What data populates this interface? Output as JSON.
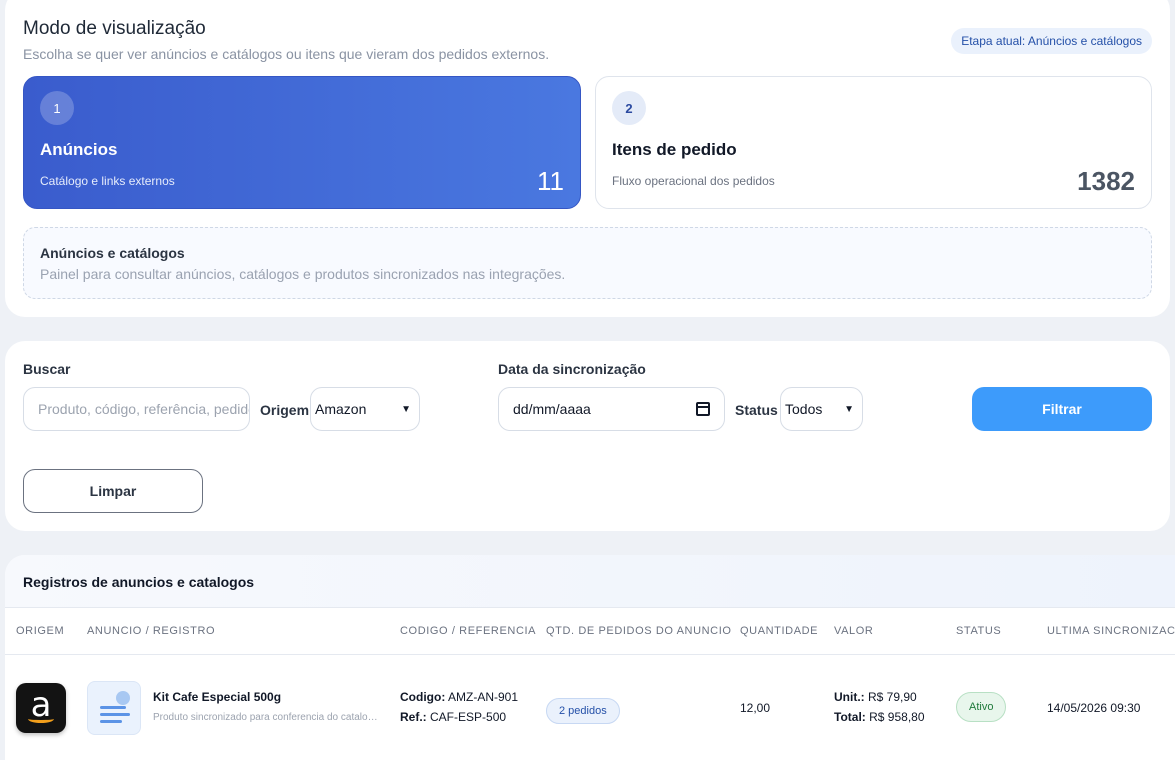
{
  "mode": {
    "title": "Modo de visualização",
    "subtitle": "Escolha se quer ver anúncios e catálogos ou itens que vieram dos pedidos externos.",
    "stage_badge": "Etapa atual: Anúncios e catálogos",
    "options": [
      {
        "num": "1",
        "title": "Anúncios",
        "desc": "Catálogo e links externos",
        "count": "11"
      },
      {
        "num": "2",
        "title": "Itens de pedido",
        "desc": "Fluxo operacional dos pedidos",
        "count": "1382"
      }
    ],
    "info": {
      "title": "Anúncios e catálogos",
      "desc": "Painel para consultar anúncios, catálogos e produtos sincronizados nas integrações."
    }
  },
  "filters": {
    "search_label": "Buscar",
    "search_placeholder": "Produto, código, referência, pedido",
    "origin_label": "Origem",
    "origin_value": "Amazon",
    "date_label": "Data da sincronização",
    "date_placeholder": "dd/mm/aaaa",
    "status_label": "Status",
    "status_value": "Todos",
    "filter_button": "Filtrar",
    "clear_button": "Limpar"
  },
  "table": {
    "title": "Registros de anuncios e catalogos",
    "columns": [
      "ORIGEM",
      "ANUNCIO / REGISTRO",
      "CODIGO / REFERENCIA",
      "QTD. DE PEDIDOS DO ANUNCIO",
      "QUANTIDADE",
      "VALOR",
      "STATUS",
      "ULTIMA SINCRONIZAC"
    ],
    "rows": [
      {
        "origin_icon": "amazon-logo-icon",
        "product_name": "Kit Cafe Especial 500g",
        "product_desc": "Produto sincronizado para conferencia do catalogo...",
        "code_label": "Codigo:",
        "code": "AMZ-AN-901",
        "ref_label": "Ref.:",
        "ref": "CAF-ESP-500",
        "orders": "2 pedidos",
        "quantity": "12,00",
        "unit_label": "Unit.:",
        "unit_value": "R$ 79,90",
        "total_label": "Total:",
        "total_value": "R$ 958,80",
        "status": "Ativo",
        "last_sync": "14/05/2026 09:30"
      }
    ]
  }
}
